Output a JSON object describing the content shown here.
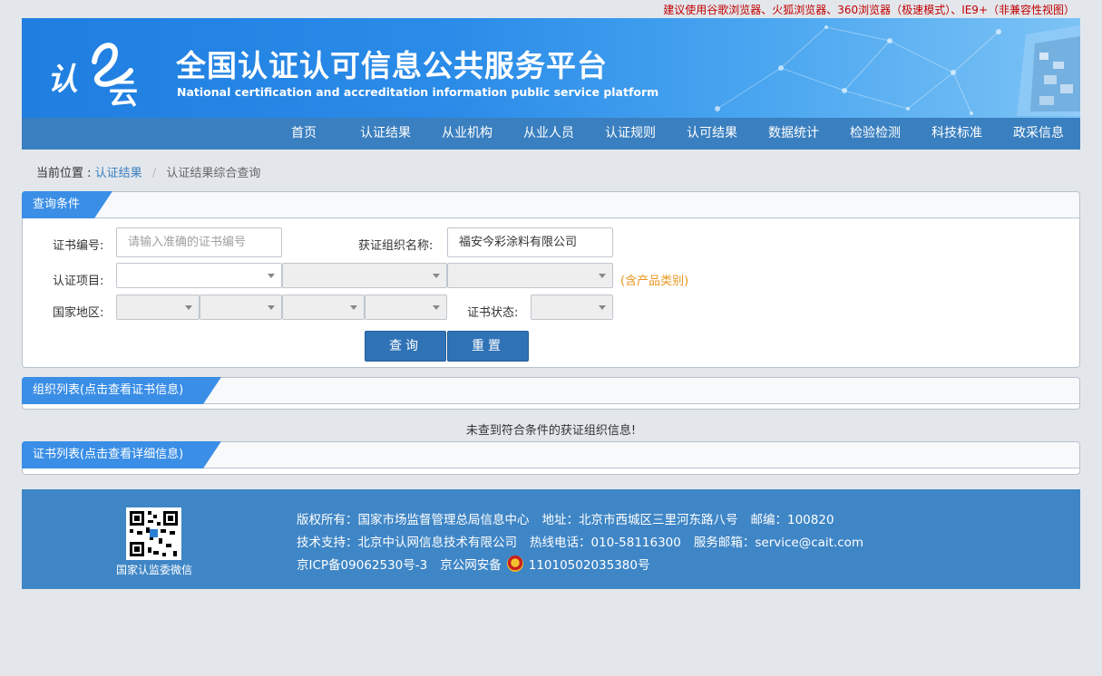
{
  "notice": "建议使用谷歌浏览器、火狐浏览器、360浏览器（极速模式）、IE9+（非兼容性视图）",
  "header": {
    "logo_text_a": "认",
    "logo_text_b": "云",
    "title": "全国认证认可信息公共服务平台",
    "subtitle": "National certification and accreditation information public service platform"
  },
  "nav": {
    "items": [
      "首页",
      "认证结果",
      "从业机构",
      "从业人员",
      "认证规则",
      "认可结果",
      "数据统计",
      "检验检测",
      "科技标准",
      "政采信息"
    ]
  },
  "breadcrumb": {
    "prefix": "当前位置 :",
    "parent": "认证结果",
    "separator": "/",
    "current": "认证结果综合查询"
  },
  "query": {
    "tab": "查询条件",
    "cert_no_label": "证书编号:",
    "cert_no_placeholder": "请输入准确的证书编号",
    "cert_no_value": "",
    "org_name_label": "获证组织名称:",
    "org_name_value": "福安今彩涂料有限公司",
    "project_label": "认证项目:",
    "project_hint": "(含产品类别)",
    "region_label": "国家地区:",
    "status_label": "证书状态:",
    "search_button": "查询",
    "reset_button": "重置"
  },
  "org_list": {
    "tab": "组织列表(点击查看证书信息)",
    "empty_message": "未查到符合条件的获证组织信息!"
  },
  "cert_list": {
    "tab": "证书列表(点击查看详细信息)"
  },
  "footer": {
    "qr_caption": "国家认监委微信",
    "copyright_label": "版权所有：",
    "copyright_value": "国家市场监督管理总局信息中心",
    "address_label": "地址：",
    "address_value": "北京市西城区三里河东路八号",
    "postcode_label": "邮编：",
    "postcode_value": "100820",
    "support_label": "技术支持：",
    "support_value": "北京中认网信息技术有限公司",
    "hotline_label": "热线电话：",
    "hotline_value": "010-58116300",
    "email_label": "服务邮箱：",
    "email_value": "service@cait.com",
    "icp": "京ICP备09062530号-3",
    "police_label": "京公网安备",
    "police_value": "11010502035380号"
  },
  "colors": {
    "nav_bg": "#3a7fbf",
    "tab_bg": "#3a8ee6",
    "button_bg": "#2f72b5",
    "footer_bg": "#3f86c6",
    "hint": "#e8961e",
    "notice": "#c00000"
  }
}
